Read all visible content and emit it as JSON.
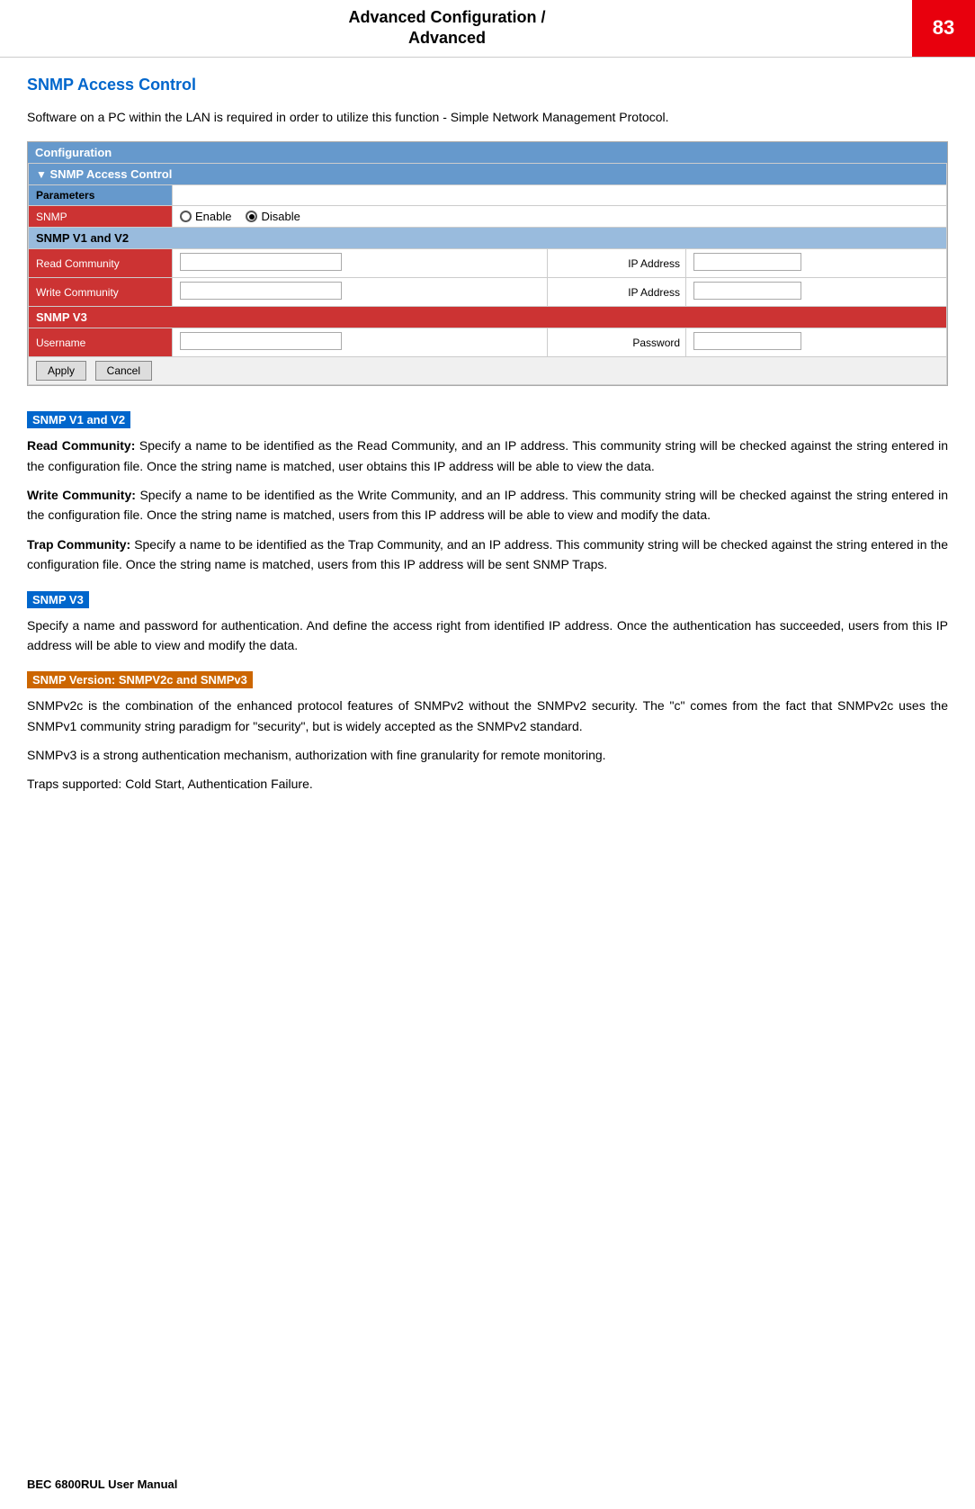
{
  "header": {
    "title_line1": "Advanced Configuration /",
    "title_line2": "Advanced",
    "page_number": "83"
  },
  "section": {
    "title": "SNMP Access Control",
    "intro": "Software on a PC within the LAN is required in order to utilize this function - Simple Network Management Protocol."
  },
  "config_box": {
    "header": "Configuration",
    "snmp_section": "SNMP Access Control",
    "parameters_label": "Parameters",
    "snmp_label": "SNMP",
    "snmp_enable": "Enable",
    "snmp_disable": "Disable",
    "snmpv1v2_label": "SNMP V1 and V2",
    "read_community_label": "Read Community",
    "write_community_label": "Write Community",
    "ip_address_label": "IP Address",
    "snmpv3_label": "SNMP V3",
    "username_label": "Username",
    "password_label": "Password",
    "apply_btn": "Apply",
    "cancel_btn": "Cancel"
  },
  "subsections": {
    "v1v2_heading": "SNMP V1 and V2",
    "v3_heading": "SNMP V3",
    "version_heading": "SNMP Version: SNMPV2c and SNMPv3"
  },
  "descriptions": {
    "read_community": "Read Community: Specify a name to be identified as the Read Community, and an IP address. This community string will be checked against the string entered in the configuration file. Once the string name is matched, user obtains this IP address will be able to view the data.",
    "write_community": "Write Community: Specify a name to be identified as the Write Community, and an IP address. This community string will be checked against the string entered in the configuration file. Once the string name is matched, users from this IP address will be able to view and modify the data.",
    "trap_community": "Trap Community:  Specify a name to be identified as the Trap Community, and an IP address. This community string will be checked against the string entered in the configuration file. Once the string name is matched, users from this IP address will be sent SNMP Traps.",
    "snmpv3": "Specify a name and password for authentication. And define the access right from identified IP address. Once the authentication has succeeded, users from this IP address will be able to view and modify the data.",
    "snmpv2c_p1": "SNMPv2c is the combination of the enhanced protocol features of SNMPv2 without the SNMPv2 security. The \"c\" comes from the fact that SNMPv2c uses the SNMPv1 community string paradigm for \"security\", but is widely accepted as the SNMPv2 standard.",
    "snmpv3_p1": "SNMPv3 is a strong authentication mechanism, authorization with fine granularity for remote monitoring.",
    "traps": "Traps supported: Cold Start, Authentication Failure."
  },
  "footer": {
    "text": "BEC 6800RUL User Manual"
  }
}
